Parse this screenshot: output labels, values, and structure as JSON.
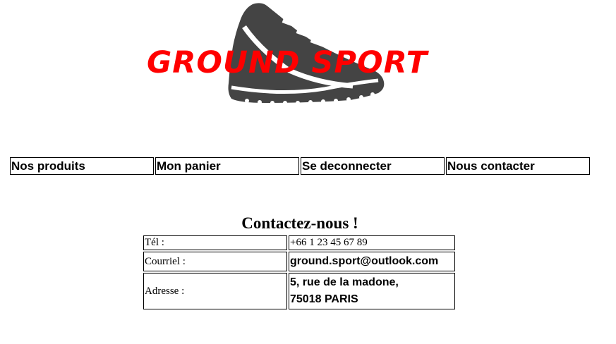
{
  "logo": {
    "text": "GROUND SPORT",
    "text_color": "#ff0000",
    "shoe_color": "#444444"
  },
  "nav": {
    "items": [
      {
        "label": "Nos produits"
      },
      {
        "label": "Mon panier"
      },
      {
        "label": "Se deconnecter"
      },
      {
        "label": "Nous contacter"
      }
    ]
  },
  "contact": {
    "title": "Contactez-nous !",
    "phone_label": "Tél :",
    "phone_value": "+66 1 23 45 67 89",
    "email_label": "Courriel :",
    "email_value": "ground.sport@outlook.com",
    "address_label": "Adresse :",
    "address_line1": "5, rue de la madone,",
    "address_line2": "75018 PARIS"
  }
}
